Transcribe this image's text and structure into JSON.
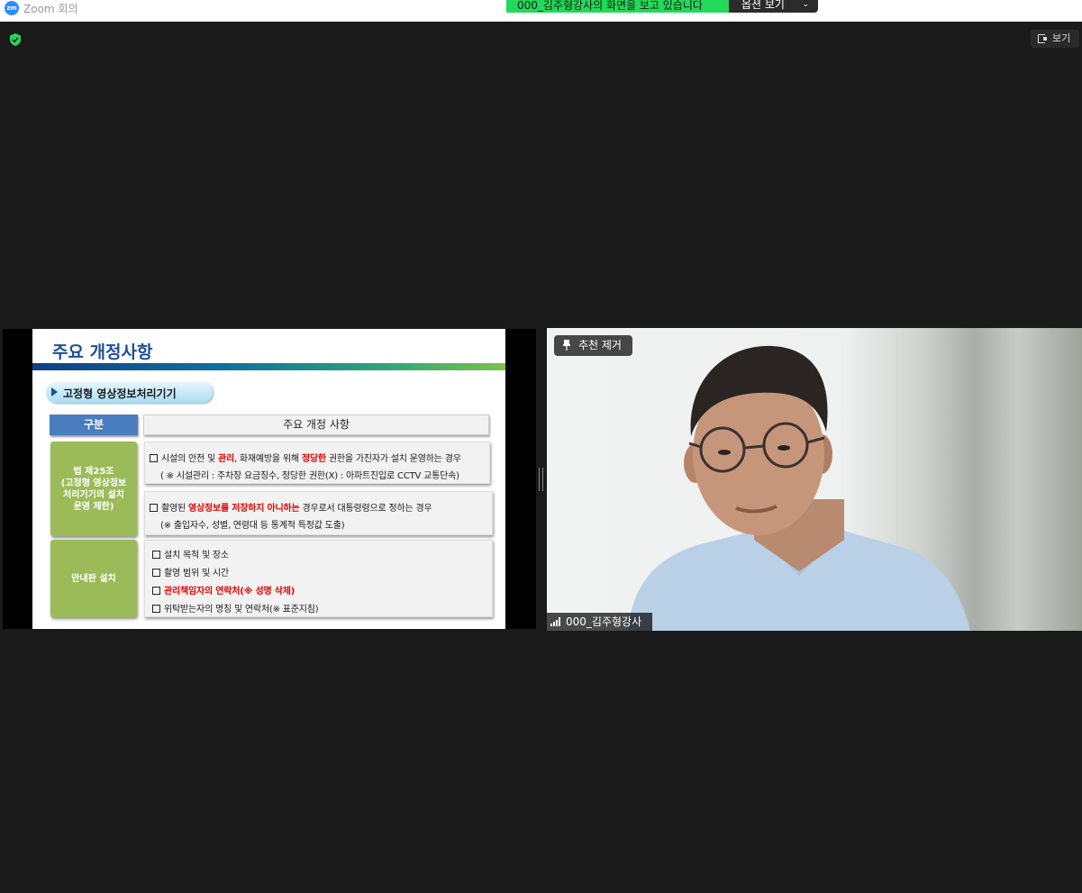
{
  "titlebar": {
    "logo": "zm",
    "title": "Zoom 회의"
  },
  "banner": {
    "text": "000_김주형강사의 화면을 보고 있습니다",
    "options_label": "옵션 보기"
  },
  "top_right": {
    "view_label": "보기"
  },
  "slide": {
    "title": "주요 개정사항",
    "section": "고정형 영상정보처리기기",
    "header_left": "구분",
    "header_right": "주요 개정 사항",
    "group1_label": "법 제25조\n(고정형 영상정보\n처리기기의 설치\n운영 제한)",
    "group2_label": "안내판 설치",
    "row1": {
      "l1_a": "시설의 안전 및 ",
      "l1_red1": "관리",
      "l1_b": ", 화재예방을 위해 ",
      "l1_red2": "정당한",
      "l1_c": " 권한을 가진자가 설치 운영하는 경우",
      "l2": "( ※ 시설관리 : 주차장 요금징수, 정당한 권한(X) : 아파트진입로 CCTV 교통단속)"
    },
    "row2": {
      "l1_a": "촬영된 ",
      "l1_red": "영상정보를 저장하지 아니하는",
      "l1_b": " 경우로서 대통령령으로  정하는 경우",
      "l2": "(※ 출입자수, 성별, 연령대 등 통계적 특정값 도출)"
    },
    "row3": {
      "l1": "설치 목적 및 장소",
      "l2": "촬영 범위 및 시간",
      "l3_red": "관리책임자의 연락처(※  성명 삭제)",
      "l4": "위탁받는자의 명칭 및 연락처(※ 표준지침)"
    }
  },
  "video": {
    "pin_label": "추천 제거",
    "name": "000_김주형강사"
  },
  "colors": {
    "accent_green": "#23d959",
    "slide_title_blue": "#1f4e9a",
    "red": "#e60000"
  }
}
